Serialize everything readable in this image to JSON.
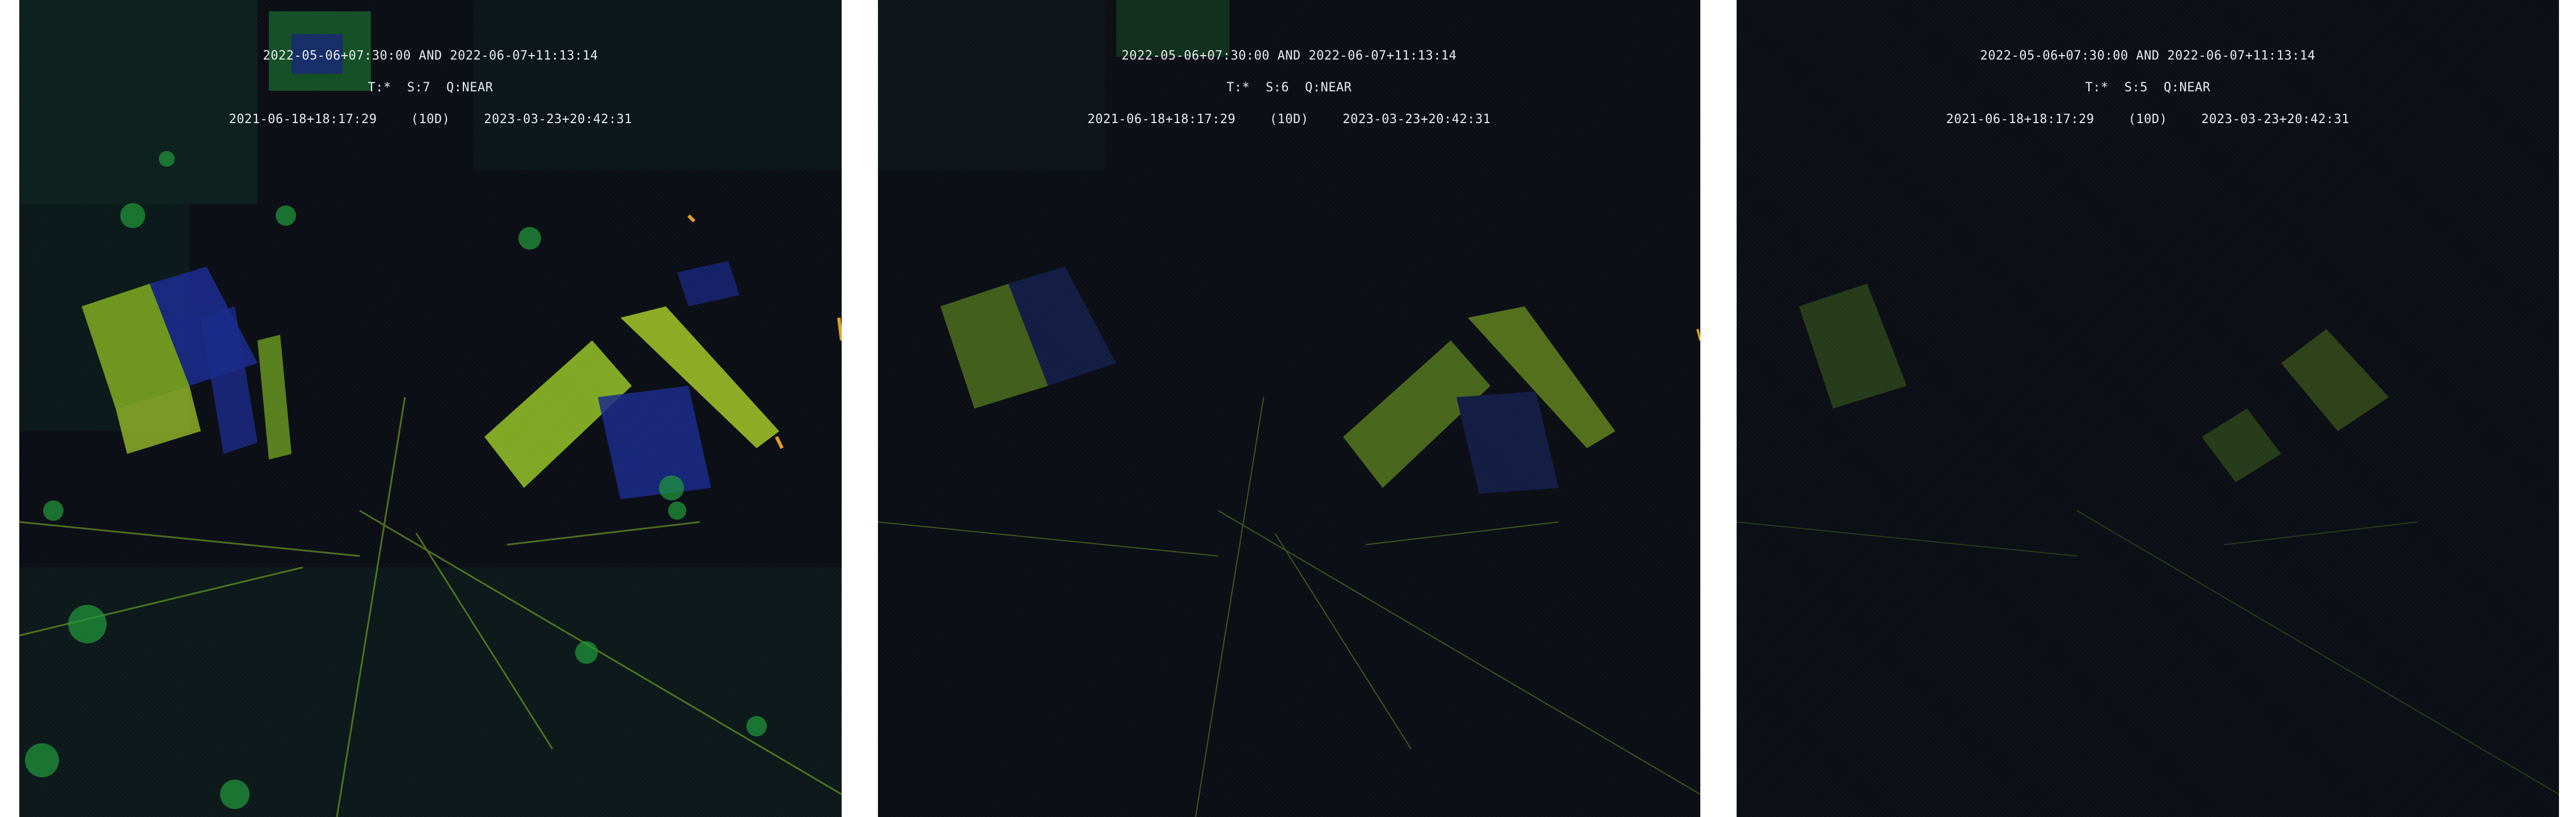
{
  "panels": [
    {
      "date_range": "2022-05-06+07:30:00 AND 2022-06-07+11:13:14",
      "t_label": "T:*",
      "s_label": "S:7",
      "q_label": "Q:NEAR",
      "start": "2021-06-18+18:17:29",
      "interval": "(10D)",
      "end": "2023-03-23+20:42:31"
    },
    {
      "date_range": "2022-05-06+07:30:00 AND 2022-06-07+11:13:14",
      "t_label": "T:*",
      "s_label": "S:6",
      "q_label": "Q:NEAR",
      "start": "2021-06-18+18:17:29",
      "interval": "(10D)",
      "end": "2023-03-23+20:42:31"
    },
    {
      "date_range": "2022-05-06+07:30:00 AND 2022-06-07+11:13:14",
      "t_label": "T:*",
      "s_label": "S:5",
      "q_label": "Q:NEAR",
      "start": "2021-06-18+18:17:29",
      "interval": "(10D)",
      "end": "2023-03-23+20:42:31"
    }
  ],
  "colors": {
    "background": "#0c0e16",
    "gutter": "#ffffff",
    "text": "#e9ecef",
    "low": "#1a2a8a",
    "mid": "#1f9a3a",
    "high": "#b8e02a",
    "peak": "#e0a020"
  }
}
